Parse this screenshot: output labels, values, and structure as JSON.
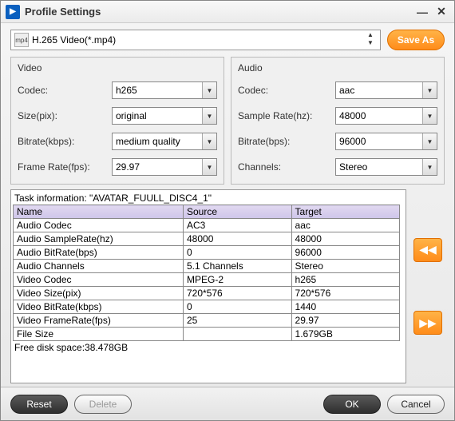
{
  "window": {
    "title": "Profile Settings"
  },
  "profile": {
    "icon_label": "mp4",
    "text": "H.265 Video(*.mp4)",
    "save_as": "Save As"
  },
  "video": {
    "heading": "Video",
    "codec_label": "Codec:",
    "codec_value": "h265",
    "size_label": "Size(pix):",
    "size_value": "original",
    "bitrate_label": "Bitrate(kbps):",
    "bitrate_value": "medium quality",
    "framerate_label": "Frame Rate(fps):",
    "framerate_value": "29.97"
  },
  "audio": {
    "heading": "Audio",
    "codec_label": "Codec:",
    "codec_value": "aac",
    "samplerate_label": "Sample Rate(hz):",
    "samplerate_value": "48000",
    "bitrate_label": "Bitrate(bps):",
    "bitrate_value": "96000",
    "channels_label": "Channels:",
    "channels_value": "Stereo"
  },
  "task": {
    "title": "Task information: \"AVATAR_FUULL_DISC4_1\"",
    "headers": {
      "name": "Name",
      "source": "Source",
      "target": "Target"
    },
    "rows": [
      {
        "name": "Audio Codec",
        "source": "AC3",
        "target": "aac"
      },
      {
        "name": "Audio SampleRate(hz)",
        "source": "48000",
        "target": "48000"
      },
      {
        "name": "Audio BitRate(bps)",
        "source": "0",
        "target": "96000"
      },
      {
        "name": "Audio Channels",
        "source": "5.1 Channels",
        "target": "Stereo"
      },
      {
        "name": "Video Codec",
        "source": "MPEG-2",
        "target": "h265"
      },
      {
        "name": "Video Size(pix)",
        "source": "720*576",
        "target": "720*576"
      },
      {
        "name": "Video BitRate(kbps)",
        "source": "0",
        "target": "1440"
      },
      {
        "name": "Video FrameRate(fps)",
        "source": "25",
        "target": "29.97"
      },
      {
        "name": "File Size",
        "source": "",
        "target": "1.679GB"
      }
    ],
    "free_disk": "Free disk space:38.478GB"
  },
  "footer": {
    "reset": "Reset",
    "delete": "Delete",
    "ok": "OK",
    "cancel": "Cancel"
  }
}
